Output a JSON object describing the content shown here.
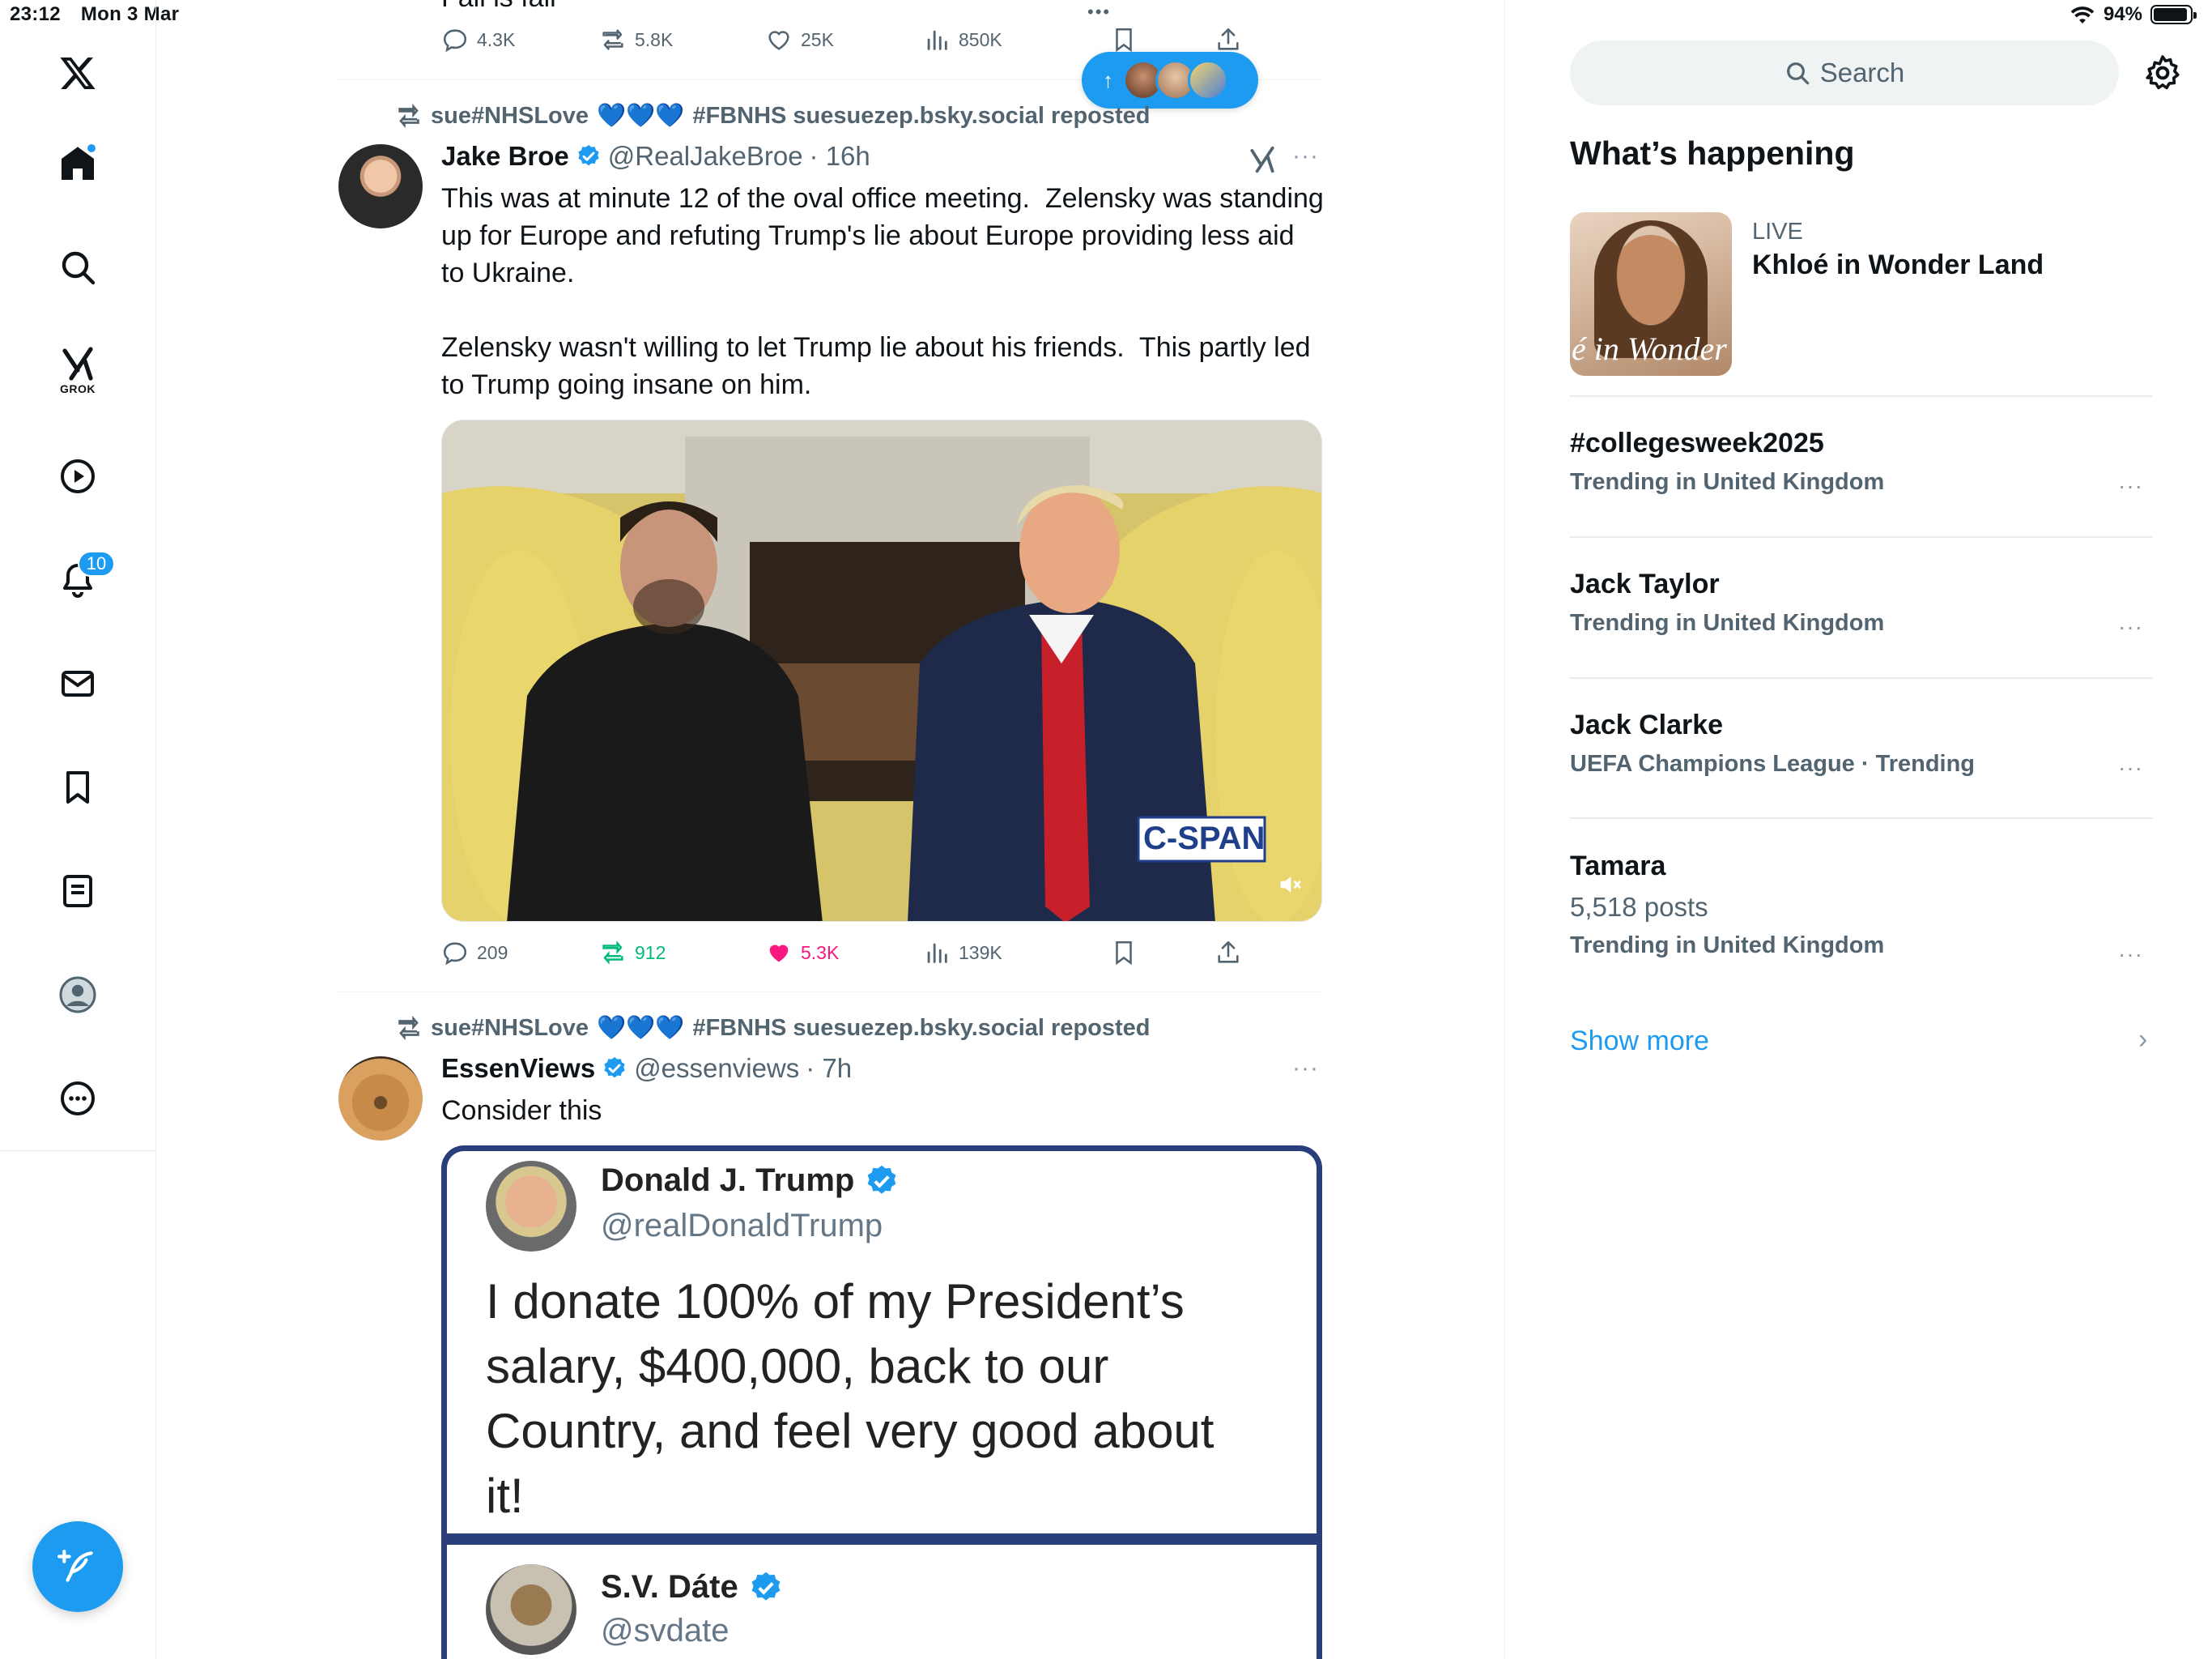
{
  "status": {
    "time": "23:12",
    "date": "Mon 3 Mar",
    "battery": "94%",
    "battery_level": 0.94
  },
  "nav": {
    "grok_label": "GROK",
    "notifications_badge": "10"
  },
  "new_posts_pill": {
    "arrow": "↑"
  },
  "top_tweet": {
    "partial_text": "Fail is fail",
    "replies": "4.3K",
    "reposts": "5.8K",
    "likes": "25K",
    "views": "850K"
  },
  "tweet1": {
    "repost_by": "sue#NHSLove",
    "repost_suffix": "#FBNHS suesuezep.bsky.social reposted",
    "name": "Jake Broe",
    "handle": "@RealJakeBroe",
    "time": "· 16h",
    "text": "This was at minute 12 of the oval office meeting.  Zelensky was standing up for Europe and refuting Trump's lie about Europe providing less aid to Ukraine.\n\nZelensky wasn't willing to let Trump lie about his friends.  This partly led to Trump going insane on him.",
    "video_watermark": "C-SPAN",
    "replies": "209",
    "reposts": "912",
    "likes": "5.3K",
    "views": "139K"
  },
  "tweet2": {
    "repost_by": "sue#NHSLove",
    "repost_suffix": "#FBNHS suesuezep.bsky.social reposted",
    "name": "EssenViews",
    "handle": "@essenviews",
    "time": "· 7h",
    "text": "Consider this",
    "embed": {
      "name1": "Donald J. Trump",
      "handle1": "@realDonaldTrump",
      "quote": "I donate 100% of my President’s salary, $400,000, back to our Country, and feel very good about it!",
      "name2": "S.V. Dáte",
      "handle2": "@svdate"
    }
  },
  "sidebar": {
    "search_placeholder": "Search",
    "whats_happening": "What’s happening",
    "live": {
      "label": "LIVE",
      "title": "Khloé in Wonder Land",
      "thumb_text": "é in Wonder L"
    },
    "trends": [
      {
        "title": "#collegesweek2025",
        "meta": "Trending in United Kingdom"
      },
      {
        "title": "Jack Taylor",
        "meta": "Trending in United Kingdom"
      },
      {
        "title": "Jack Clarke",
        "meta": "UEFA Champions League · Trending"
      },
      {
        "title": "Tamara",
        "posts": "5,518 posts",
        "meta": "Trending in United Kingdom"
      }
    ],
    "show_more": "Show more"
  },
  "colors": {
    "accent": "#1d9bf0",
    "like": "#f91880",
    "repost_active": "#00ba7c",
    "text_secondary": "#536471"
  }
}
